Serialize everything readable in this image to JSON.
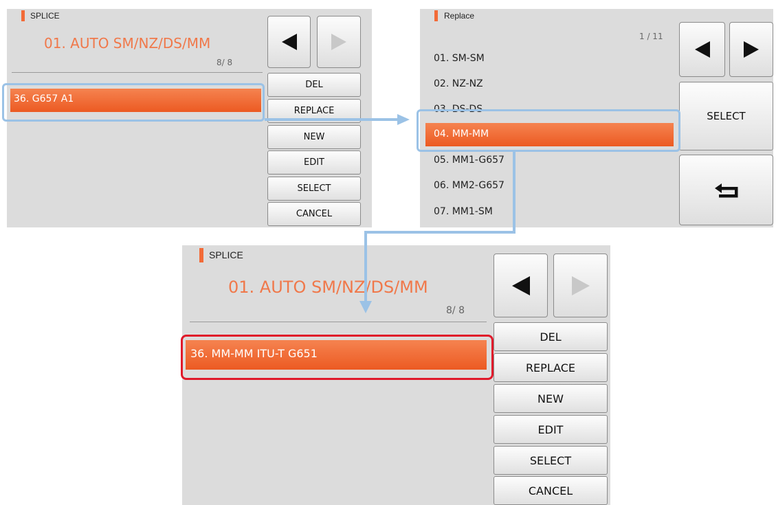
{
  "panel1": {
    "title": "SPLICE",
    "mode": "01. AUTO SM/NZ/DS/MM",
    "page": "8/ 8",
    "selected_item": "36. G657 A1",
    "buttons": [
      "DEL",
      "REPLACE",
      "NEW",
      "EDIT",
      "SELECT",
      "CANCEL"
    ]
  },
  "panel2": {
    "title": "Replace",
    "page": "1 / 11",
    "items": [
      "01. SM-SM",
      "02. NZ-NZ",
      "03. DS-DS",
      "04. MM-MM",
      "05. MM1-G657",
      "06. MM2-G657",
      "07. MM1-SM"
    ],
    "selected_index": 3,
    "select_label": "SELECT"
  },
  "panel3": {
    "title": "SPLICE",
    "mode": "01. AUTO SM/NZ/DS/MM",
    "page": "8/ 8",
    "selected_item": "36. MM-MM ITU-T G651",
    "buttons": [
      "DEL",
      "REPLACE",
      "NEW",
      "EDIT",
      "SELECT",
      "CANCEL"
    ]
  },
  "colors": {
    "accent": "#f26b38",
    "highlight_blue": "#9bc2e6",
    "highlight_red": "#e0192a",
    "screen_bg": "#dcdcdc"
  },
  "icons": {
    "prev": "left-triangle-icon",
    "next": "right-triangle-icon",
    "back": "return-arrow-icon"
  }
}
